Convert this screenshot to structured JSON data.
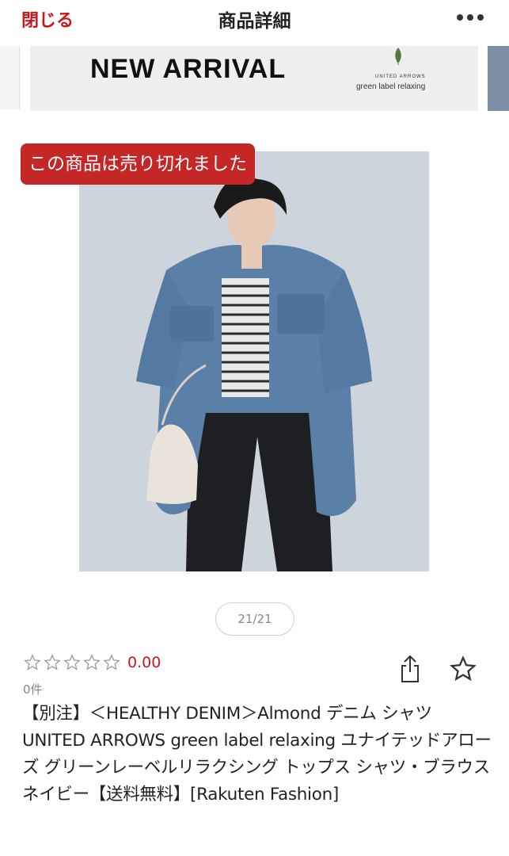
{
  "header": {
    "close_label": "閉じる",
    "title": "商品詳細",
    "more_icon": "more-horizontal-icon"
  },
  "banner": {
    "headline": "NEW ARRIVAL",
    "brand_small": "UNITED ARROWS",
    "brand_name": "green label relaxing",
    "leaf_color": "#4e7a3d"
  },
  "product": {
    "soldout_badge": "この商品は売り切れました",
    "image_description_icon": "product-photo",
    "pager": "21/21",
    "rating_value": "0.00",
    "review_count": "0件",
    "title": "【別注】＜HEALTHY DENIM＞Almond デニム シャツ UNITED ARROWS green label relaxing ユナイテッドアローズ グリーンレーベルリラクシング トップス シャツ・ブラウス ネイビー【送料無料】[Rakuten Fashion]"
  },
  "colors": {
    "accent_red": "#c9171e",
    "badge_red": "#c52626"
  }
}
